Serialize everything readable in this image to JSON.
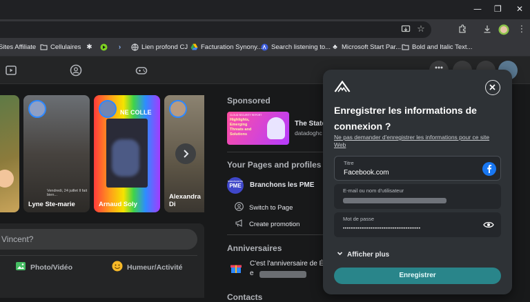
{
  "window": {
    "minimize": "—",
    "restore": "❐",
    "close": "✕"
  },
  "bookmarks": [
    {
      "label": "Sites Affiliate",
      "icon": "bookmark-icon"
    },
    {
      "label": "Cellulaires",
      "icon": "folder-icon"
    },
    {
      "label": "",
      "icon": "bug-icon"
    },
    {
      "label": "",
      "icon": "play-icon"
    },
    {
      "label": "",
      "icon": "chevron-icon"
    },
    {
      "label": "Lien profond CJ",
      "icon": "globe-icon"
    },
    {
      "label": "Facturation Synony...",
      "icon": "drive-icon"
    },
    {
      "label": "Search listening to...",
      "icon": "search-icon"
    },
    {
      "label": "Microsoft Start Par...",
      "icon": "plant-icon"
    },
    {
      "label": "Bold and Italic Text...",
      "icon": "folder-icon"
    }
  ],
  "stories": [
    {
      "name": "Lyne Ste-marie",
      "meta": "Vendredi, 24 juillet Il fait bien..."
    },
    {
      "name": "Arnaud Soly",
      "overlay": "NE COLLE"
    },
    {
      "name": "Alexandra Di"
    }
  ],
  "composer": {
    "placeholder": "Vincent?",
    "photo_label": "Photo/Vidéo",
    "mood_label": "Humeur/Activité"
  },
  "sponsored": {
    "header": "Sponsored",
    "ad_title": "The State",
    "ad_domain": "datadoghc",
    "ad_image_text": [
      "Highlights,",
      "Emerging",
      "Threats and",
      "Solutions"
    ],
    "ad_image_top": "CLOUD SECURITY REPORT"
  },
  "pages": {
    "header": "Your Pages and profiles",
    "page_name": "Branchons les PME",
    "page_logo_text": "PME",
    "page_logo_small": "branchons les",
    "switch_label": "Switch to Page",
    "promo_label": "Create promotion"
  },
  "birthdays": {
    "header": "Anniversaires",
    "line1": "C'est l'anniversaire de É",
    "line2": "e"
  },
  "contacts": {
    "header": "Contacts"
  },
  "popup": {
    "title": "Enregistrer les informations de connexion ?",
    "never_link": "Ne pas demander d'enregistrer les informations pour ce site Web",
    "title_label": "Titre",
    "title_value": "Facebook.com",
    "email_label": "E-mail ou nom d'utilisateur",
    "password_label": "Mot de passe",
    "password_value": "••••••••••••••••••••••••••••••••••••••••••",
    "more_label": "Afficher plus",
    "save_label": "Enregistrer"
  },
  "colors": {
    "accent": "#29858a",
    "fb_blue": "#2d88ff",
    "popup_bg": "#2e3236"
  }
}
